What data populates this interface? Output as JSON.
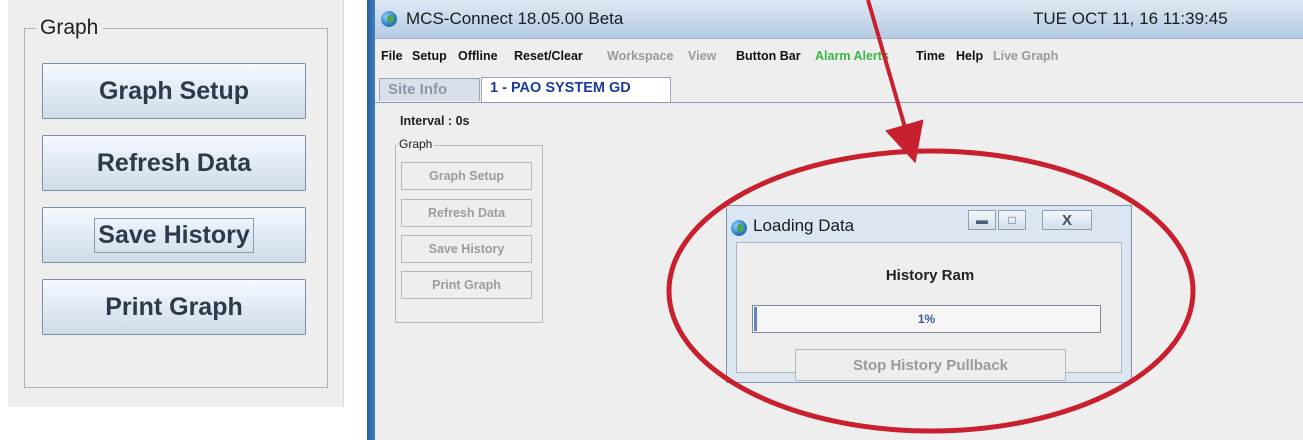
{
  "zoom": {
    "group_label": "Graph",
    "buttons": [
      "Graph Setup",
      "Refresh Data",
      "Save History",
      "Print Graph"
    ]
  },
  "window": {
    "title": "MCS-Connect 18.05.00 Beta",
    "clock": "TUE OCT 11, 16  11:39:45"
  },
  "menu": [
    {
      "label": "File",
      "state": "enabled"
    },
    {
      "label": "Setup",
      "state": "enabled"
    },
    {
      "label": "Offline",
      "state": "enabled"
    },
    {
      "label": "Reset/Clear",
      "state": "enabled"
    },
    {
      "label": "Workspace",
      "state": "disabled"
    },
    {
      "label": "View",
      "state": "disabled"
    },
    {
      "label": "Button Bar",
      "state": "enabled"
    },
    {
      "label": "Alarm Alerts",
      "state": "highlight"
    },
    {
      "label": "Time",
      "state": "enabled"
    },
    {
      "label": "Help",
      "state": "enabled"
    },
    {
      "label": "Live Graph",
      "state": "disabled"
    }
  ],
  "tabs": [
    "Site Info",
    "1 - PAO SYSTEM GD"
  ],
  "interval_label": "Interval : 0s",
  "graph_group": {
    "label": "Graph",
    "buttons": [
      "Graph Setup",
      "Refresh Data",
      "Save History",
      "Print Graph"
    ]
  },
  "dialog": {
    "title": "Loading Data",
    "close_glyph": "X",
    "heading": "History Ram",
    "progress_fraction": 0.01,
    "progress_text": "1%",
    "stop_button": "Stop History Pullback"
  },
  "colors": {
    "annotation": "#c8202e",
    "menu_highlight": "#39b54a",
    "active_tab_text": "#1a3c9c",
    "progress_fill": "#5f86c2"
  },
  "icons": {
    "app": "globe-icon",
    "minimize": "minimize-icon",
    "maximize": "maximize-icon",
    "close": "close-icon"
  }
}
